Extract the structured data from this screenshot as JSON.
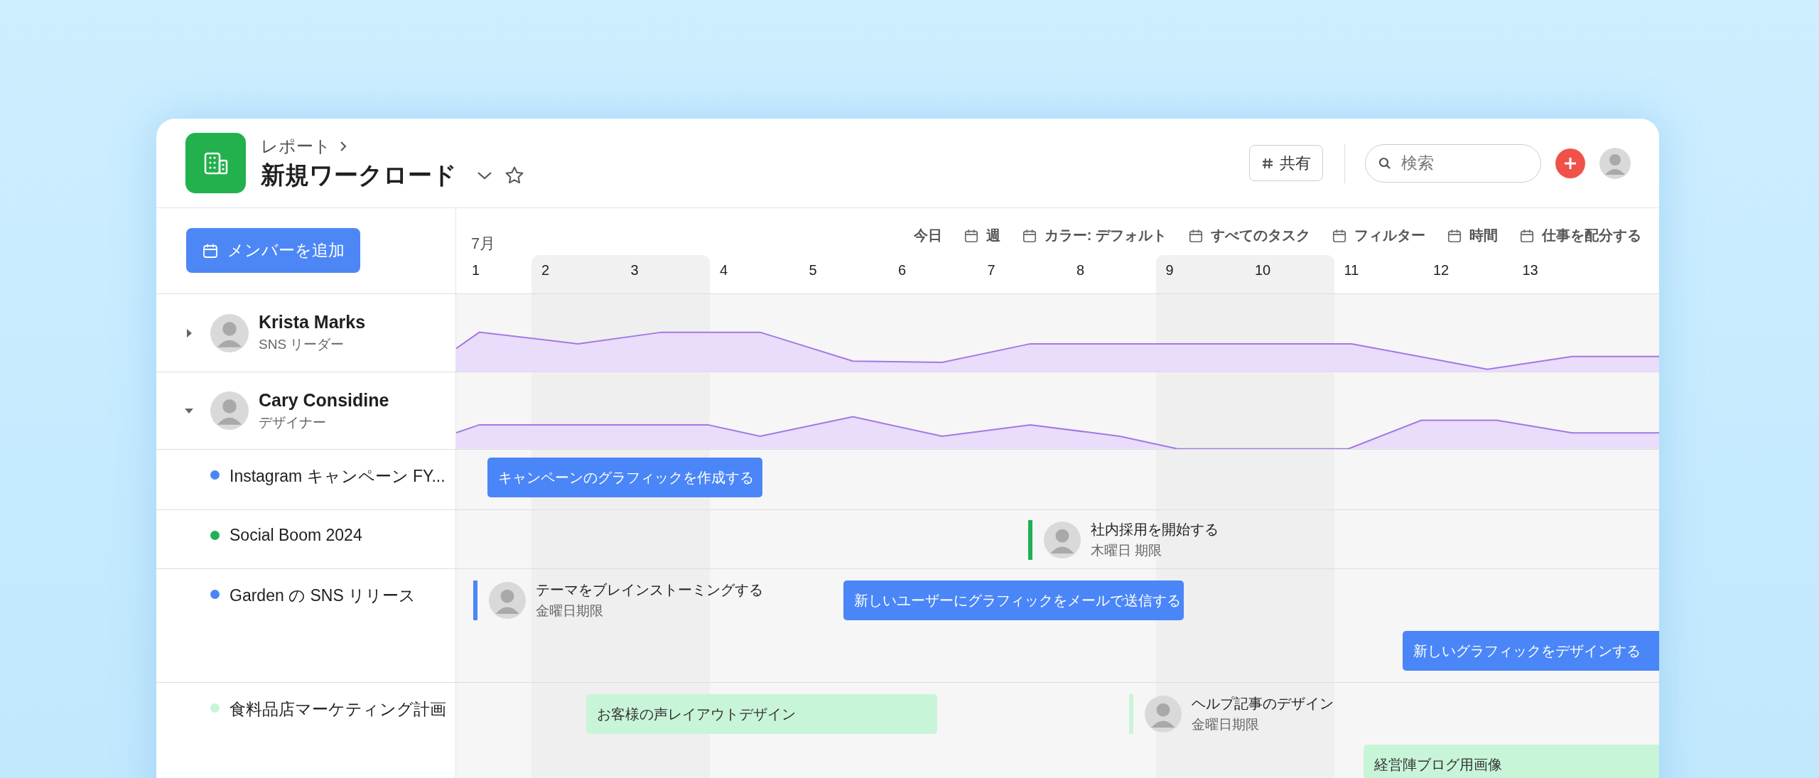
{
  "breadcrumb": "レポート",
  "title": "新規ワークロード",
  "share_button": "共有",
  "search": {
    "placeholder": "検索"
  },
  "toolbar": {
    "today": "今日",
    "items": [
      "週",
      "カラー: デフォルト",
      "すべてのタスク",
      "フィルター",
      "時間",
      "仕事を配分する"
    ]
  },
  "add_member_button": "メンバーを追加",
  "month": "7月",
  "days": [
    {
      "label": "1",
      "weekend": false
    },
    {
      "label": "2",
      "weekend": true
    },
    {
      "label": "3",
      "weekend": true
    },
    {
      "label": "4",
      "weekend": false
    },
    {
      "label": "5",
      "weekend": false
    },
    {
      "label": "6",
      "weekend": false
    },
    {
      "label": "7",
      "weekend": false
    },
    {
      "label": "8",
      "weekend": false
    },
    {
      "label": "9",
      "weekend": true
    },
    {
      "label": "10",
      "weekend": true
    },
    {
      "label": "11",
      "weekend": false
    },
    {
      "label": "12",
      "weekend": false
    },
    {
      "label": "13",
      "weekend": false
    }
  ],
  "members": [
    {
      "name": "Krista Marks",
      "role": "SNS リーダー",
      "expanded": false
    },
    {
      "name": "Cary Considine",
      "role": "デザイナー",
      "expanded": true,
      "children": [
        {
          "name": "Instagram キャンペーン FY...",
          "color": "#4a86f7",
          "tasks": [
            {
              "kind": "bar",
              "title": "キャンペーンのグラフィックを作成する"
            }
          ]
        },
        {
          "name": "Social Boom 2024",
          "color": "#1fb155",
          "tasks": [
            {
              "kind": "milestone",
              "title": "社内採用を開始する",
              "due": "木曜日 期限"
            }
          ]
        },
        {
          "name": "Garden の SNS リリース",
          "color": "#4a86f7",
          "tasks": [
            {
              "kind": "milestone",
              "title": "テーマをブレインストーミングする",
              "due": "金曜日期限"
            },
            {
              "kind": "bar",
              "title": "新しいユーザーにグラフィックをメールで送信する"
            },
            {
              "kind": "bar",
              "title": "新しいグラフィックをデザインする"
            }
          ]
        },
        {
          "name": "食料品店マーケティング計画",
          "color": "#c8f5d8",
          "tasks": [
            {
              "kind": "bar",
              "title": "お客様の声レイアウトデザイン"
            },
            {
              "kind": "milestone",
              "title": "ヘルプ記事のデザイン",
              "due": "金曜日期限"
            },
            {
              "kind": "bar",
              "title": "経営陣ブログ用画像"
            }
          ]
        }
      ]
    }
  ]
}
